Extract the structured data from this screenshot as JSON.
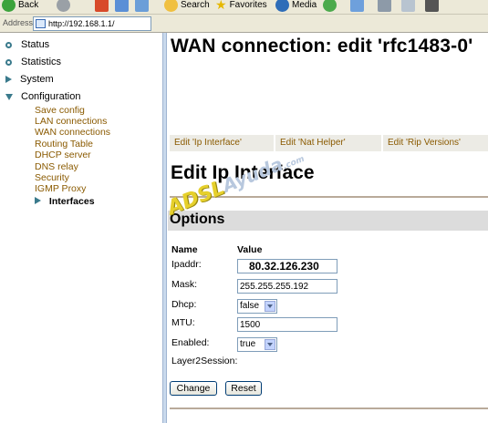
{
  "toolbar": {
    "back": "Back",
    "search": "Search",
    "favorites": "Favorites",
    "media": "Media"
  },
  "address": {
    "label": "Address",
    "url": "http://192.168.1.1/"
  },
  "sidebar": {
    "items": [
      {
        "label": "Status"
      },
      {
        "label": "Statistics"
      },
      {
        "label": "System"
      },
      {
        "label": "Configuration"
      }
    ],
    "sub_items": [
      {
        "label": "Save config"
      },
      {
        "label": "LAN connections"
      },
      {
        "label": "WAN connections"
      },
      {
        "label": "Routing Table"
      },
      {
        "label": "DHCP server"
      },
      {
        "label": "DNS relay"
      },
      {
        "label": "Security"
      },
      {
        "label": "IGMP Proxy"
      },
      {
        "label": "Interfaces"
      }
    ]
  },
  "main": {
    "title": "WAN connection: edit 'rfc1483-0'",
    "tabs": [
      {
        "label": "Edit 'Ip Interface'"
      },
      {
        "label": "Edit 'Nat Helper'"
      },
      {
        "label": "Edit 'Rip Versions'"
      }
    ],
    "section_title": "Edit Ip Interface",
    "options_title": "Options",
    "col_name": "Name",
    "col_value": "Value",
    "fields": {
      "ipaddr_label": "Ipaddr:",
      "ipaddr_value": "80.32.126.230",
      "mask_label": "Mask:",
      "mask_value": "255.255.255.192",
      "dhcp_label": "Dhcp:",
      "dhcp_value": "false",
      "mtu_label": "MTU:",
      "mtu_value": "1500",
      "enabled_label": "Enabled:",
      "enabled_value": "true",
      "layer2_label": "Layer2Session:"
    },
    "buttons": {
      "change": "Change",
      "reset": "Reset"
    }
  },
  "watermark": {
    "part1": "ADSL",
    "part2": "Ayuda",
    "part3": ".com"
  },
  "colors": {
    "accent_icon": "#3a7a8c",
    "link": "#8a5a00",
    "watermark_yellow": "#e6d02c"
  }
}
